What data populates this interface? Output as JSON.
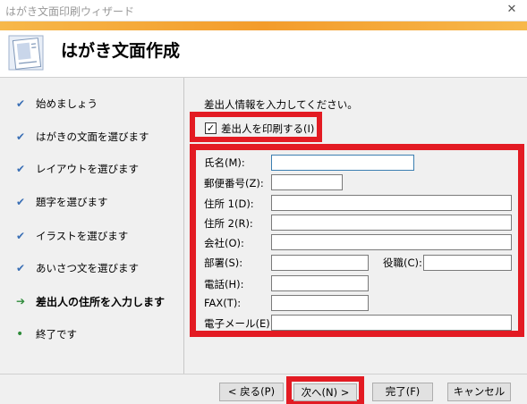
{
  "window": {
    "title": "はがき文面印刷ウィザード",
    "close_label": "✕"
  },
  "header": {
    "title": "はがき文面作成",
    "icon": "postcard-wizard-icon",
    "accent_color": "#f39c2b"
  },
  "steps": [
    {
      "label": "始めましょう",
      "status": "done",
      "mark": "✔"
    },
    {
      "label": "はがきの文面を選びます",
      "status": "done",
      "mark": "✔"
    },
    {
      "label": "レイアウトを選びます",
      "status": "done",
      "mark": "✔"
    },
    {
      "label": "題字を選びます",
      "status": "done",
      "mark": "✔"
    },
    {
      "label": "イラストを選びます",
      "status": "done",
      "mark": "✔"
    },
    {
      "label": "あいさつ文を選びます",
      "status": "done",
      "mark": "✔"
    },
    {
      "label": "差出人の住所を入力します",
      "status": "current",
      "mark": "➔"
    },
    {
      "label": "終了です",
      "status": "pending",
      "mark": "•"
    }
  ],
  "content": {
    "prompt": "差出人情報を入力してください。",
    "print_sender": {
      "label": "差出人を印刷する(I)",
      "checked": true,
      "check_glyph": "✓"
    },
    "fields": {
      "name": {
        "label": "氏名(M):",
        "value": ""
      },
      "postal": {
        "label": "郵便番号(Z):",
        "value": ""
      },
      "address1": {
        "label": "住所 1(D):",
        "value": ""
      },
      "address2": {
        "label": "住所 2(R):",
        "value": ""
      },
      "company": {
        "label": "会社(O):",
        "value": ""
      },
      "department": {
        "label": "部署(S):",
        "value": ""
      },
      "title": {
        "label": "役職(C):",
        "value": ""
      },
      "phone": {
        "label": "電話(H):",
        "value": ""
      },
      "fax": {
        "label": "FAX(T):",
        "value": ""
      },
      "email": {
        "label": "電子メール(E):",
        "value": ""
      }
    },
    "highlight_color": "#e31b23"
  },
  "footer": {
    "back": "< 戻る(P)",
    "next": "次へ(N) >",
    "finish": "完了(F)",
    "cancel": "キャンセル"
  }
}
